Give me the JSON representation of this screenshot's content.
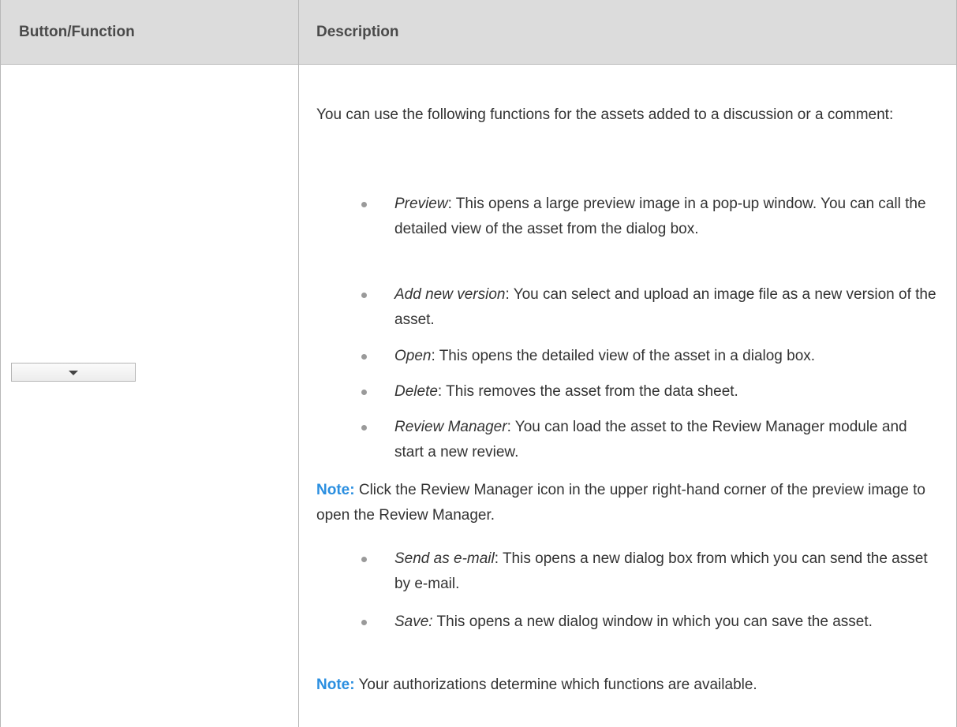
{
  "table": {
    "headers": {
      "col1": "Button/Function",
      "col2": "Description"
    },
    "control": {
      "type": "dropdown",
      "icon": "chevron-down-icon"
    },
    "intro": "You can use the following functions for the assets added to a discussion or a comment:",
    "bullets": [
      {
        "term": "Preview",
        "separator": ": ",
        "text": "This opens a large preview image in a pop-up window. You can call the detailed view of the asset from the dialog box."
      },
      {
        "term": "Add new version",
        "separator": ": ",
        "text": "You can select and upload an image file as a new version of the asset."
      },
      {
        "term": "Open",
        "separator": ": ",
        "text": "This opens the detailed view of the asset in a dialog box."
      },
      {
        "term": "Delete",
        "separator": ": ",
        "text": "This removes the asset from the data sheet."
      },
      {
        "term": "Review Manager",
        "separator": ": ",
        "text": "You can load the asset to the Review Manager module and start a new review."
      }
    ],
    "note1": {
      "label": "Note:",
      "text": " Click the Review Manager icon in the upper right-hand corner of the preview image to open the Review Manager."
    },
    "bullets2": [
      {
        "term": "Send as e-mail",
        "separator": ": ",
        "text": "This opens a new dialog box from which you can send the asset by e-mail."
      },
      {
        "term": "Save:",
        "separator": " ",
        "text": "This opens a new dialog window in which you can save the asset."
      }
    ],
    "note2": {
      "label": "Note:",
      "text": " Your authorizations determine which functions are available."
    },
    "colors": {
      "header_bg": "#dcdcdc",
      "note_label": "#2b8fe0",
      "border": "#b8b8b8"
    }
  }
}
